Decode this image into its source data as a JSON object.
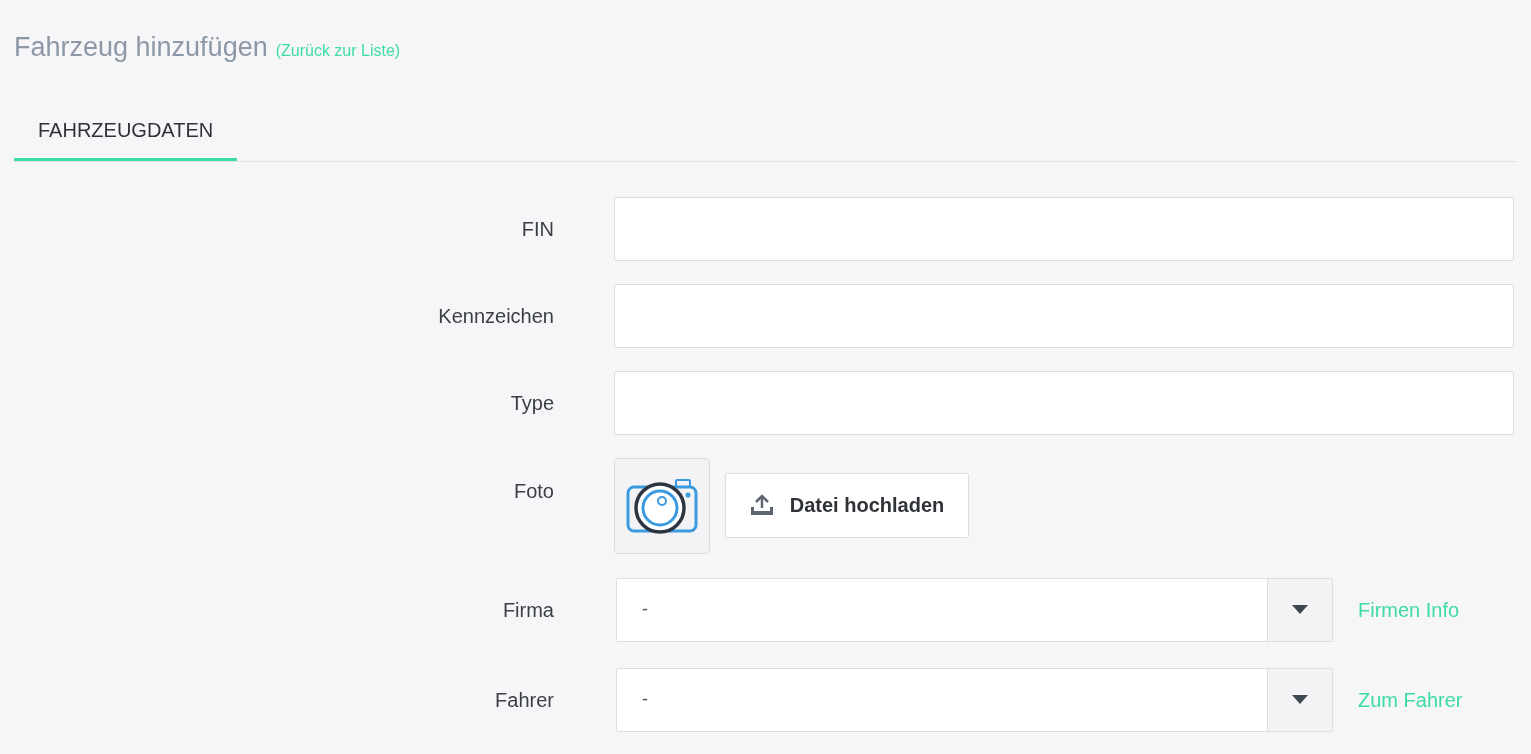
{
  "title": "Fahrzeug hinzufügen",
  "back_link": "(Zurück zur Liste)",
  "tabs": [
    {
      "label": "FAHRZEUGDATEN",
      "selected": true
    }
  ],
  "fields": [
    {
      "kind": "text",
      "label": "FIN"
    },
    {
      "kind": "text",
      "label": "Kennzeichen"
    },
    {
      "kind": "text",
      "label": "Type"
    },
    {
      "kind": "photo",
      "label": "Foto",
      "button": "Datei hochladen"
    },
    {
      "kind": "select",
      "label": "Firma",
      "value": "-",
      "link": "Firmen Info"
    },
    {
      "kind": "select",
      "label": "Fahrer",
      "value": "-",
      "link": "Zum Fahrer"
    }
  ]
}
